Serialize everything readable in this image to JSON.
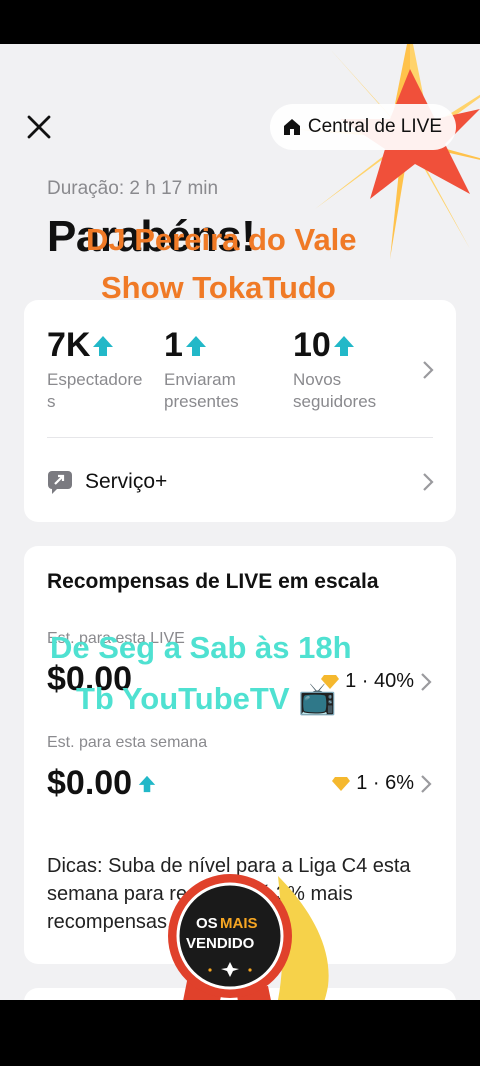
{
  "header": {
    "close_icon": "close-icon",
    "live_center_label": "Central de LIVE",
    "home_icon": "home-icon"
  },
  "summary": {
    "duration": "Duração: 2 h 17 min",
    "title": "Parabéns!"
  },
  "overlay": {
    "line1": "DJ Pereira do Vale",
    "line2": "Show TokaTudo",
    "schedule1": "De Seg a Sab às 18h",
    "schedule2": "Tb YouTubeTV 📺",
    "seal_line1a": "OS",
    "seal_line1b": "MAIS",
    "seal_line2": "VENDIDO"
  },
  "stats": [
    {
      "value": "7K",
      "label_line1": "Espectadore",
      "label_line2": "s"
    },
    {
      "value": "1",
      "label_line1": "Enviaram",
      "label_line2": "presentes"
    },
    {
      "value": "10",
      "label_line1": "Novos",
      "label_line2": "seguidores"
    }
  ],
  "service": {
    "label": "Serviço+"
  },
  "rewards": {
    "title": "Recompensas de LIVE em escala",
    "live_label": "Est. para esta LIVE",
    "live_amount": "$0.00",
    "live_badge": "1 · 40%",
    "week_label": "Est. para esta semana",
    "week_amount": "$0.00",
    "week_badge": "1 · 6%",
    "tips": "Dicas: Suba de nível para a Liga C4 esta semana para receber até 3% mais recompensas."
  },
  "colors": {
    "accent_up": "#22b8c8",
    "orange_text": "#f07a26",
    "cyan_text": "#4fe1d1",
    "burst_red": "#f0503a",
    "burst_yellow": "#ffd36b"
  }
}
